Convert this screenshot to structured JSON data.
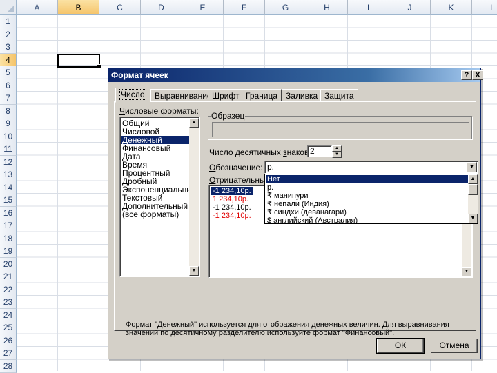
{
  "spreadsheet": {
    "columns": [
      "A",
      "B",
      "C",
      "D",
      "E",
      "F",
      "G",
      "H",
      "I",
      "J",
      "K",
      "L"
    ],
    "rows": [
      "1",
      "2",
      "3",
      "4",
      "5",
      "6",
      "7",
      "8",
      "9",
      "10",
      "11",
      "12",
      "13",
      "14",
      "15",
      "16",
      "17",
      "18",
      "19",
      "20",
      "21",
      "22",
      "23",
      "24",
      "25",
      "26",
      "27",
      "28"
    ],
    "active_column": "B",
    "active_row": "4"
  },
  "dialog": {
    "title": "Формат ячеек",
    "help_button": "?",
    "close_button": "X",
    "tabs": [
      "Число",
      "Выравнивание",
      "Шрифт",
      "Граница",
      "Заливка",
      "Защита"
    ],
    "selected_tab": "Число",
    "formats_label_pre": "",
    "formats_label_u": "Ч",
    "formats_label_post": "исловые форматы:",
    "formats": [
      "Общий",
      "Числовой",
      "Денежный",
      "Финансовый",
      "Дата",
      "Время",
      "Процентный",
      "Дробный",
      "Экспоненциальный",
      "Текстовый",
      "Дополнительный",
      "(все форматы)"
    ],
    "selected_format": "Денежный",
    "sample_label": "Образец",
    "decimals_label_pre": "Число десятичных ",
    "decimals_label_u": "з",
    "decimals_label_post": "наков:",
    "decimals_value": "2",
    "symbol_label_pre": "",
    "symbol_label_u": "О",
    "symbol_label_post": "бозначение:",
    "symbol_value": "р.",
    "negative_label_pre": "",
    "negative_label_u": "О",
    "negative_label_post": "трицательные",
    "negative_formats": [
      {
        "text": "-1 234,10р.",
        "red": false
      },
      {
        "text": "1 234,10р.",
        "red": true
      },
      {
        "text": "-1 234,10р.",
        "red": false
      },
      {
        "text": "-1 234,10р.",
        "red": true
      }
    ],
    "symbol_options": [
      "Нет",
      "р.",
      "₹ манипури",
      "₹ непали (Индия)",
      "₹ синдхи (деванагари)",
      "$ английский (Австралия)"
    ],
    "selected_symbol_option": "Нет",
    "description": "Формат \"Денежный\" используется для отображения денежных величин. Для выравнивания значений по десятичному разделителю используйте формат \"Финансовый\".",
    "ok_label": "ОК",
    "cancel_label": "Отмена",
    "colors": {
      "selection": "#0a246a",
      "negative_red": "#e00000",
      "dialog_face": "#d4d0c8"
    }
  }
}
